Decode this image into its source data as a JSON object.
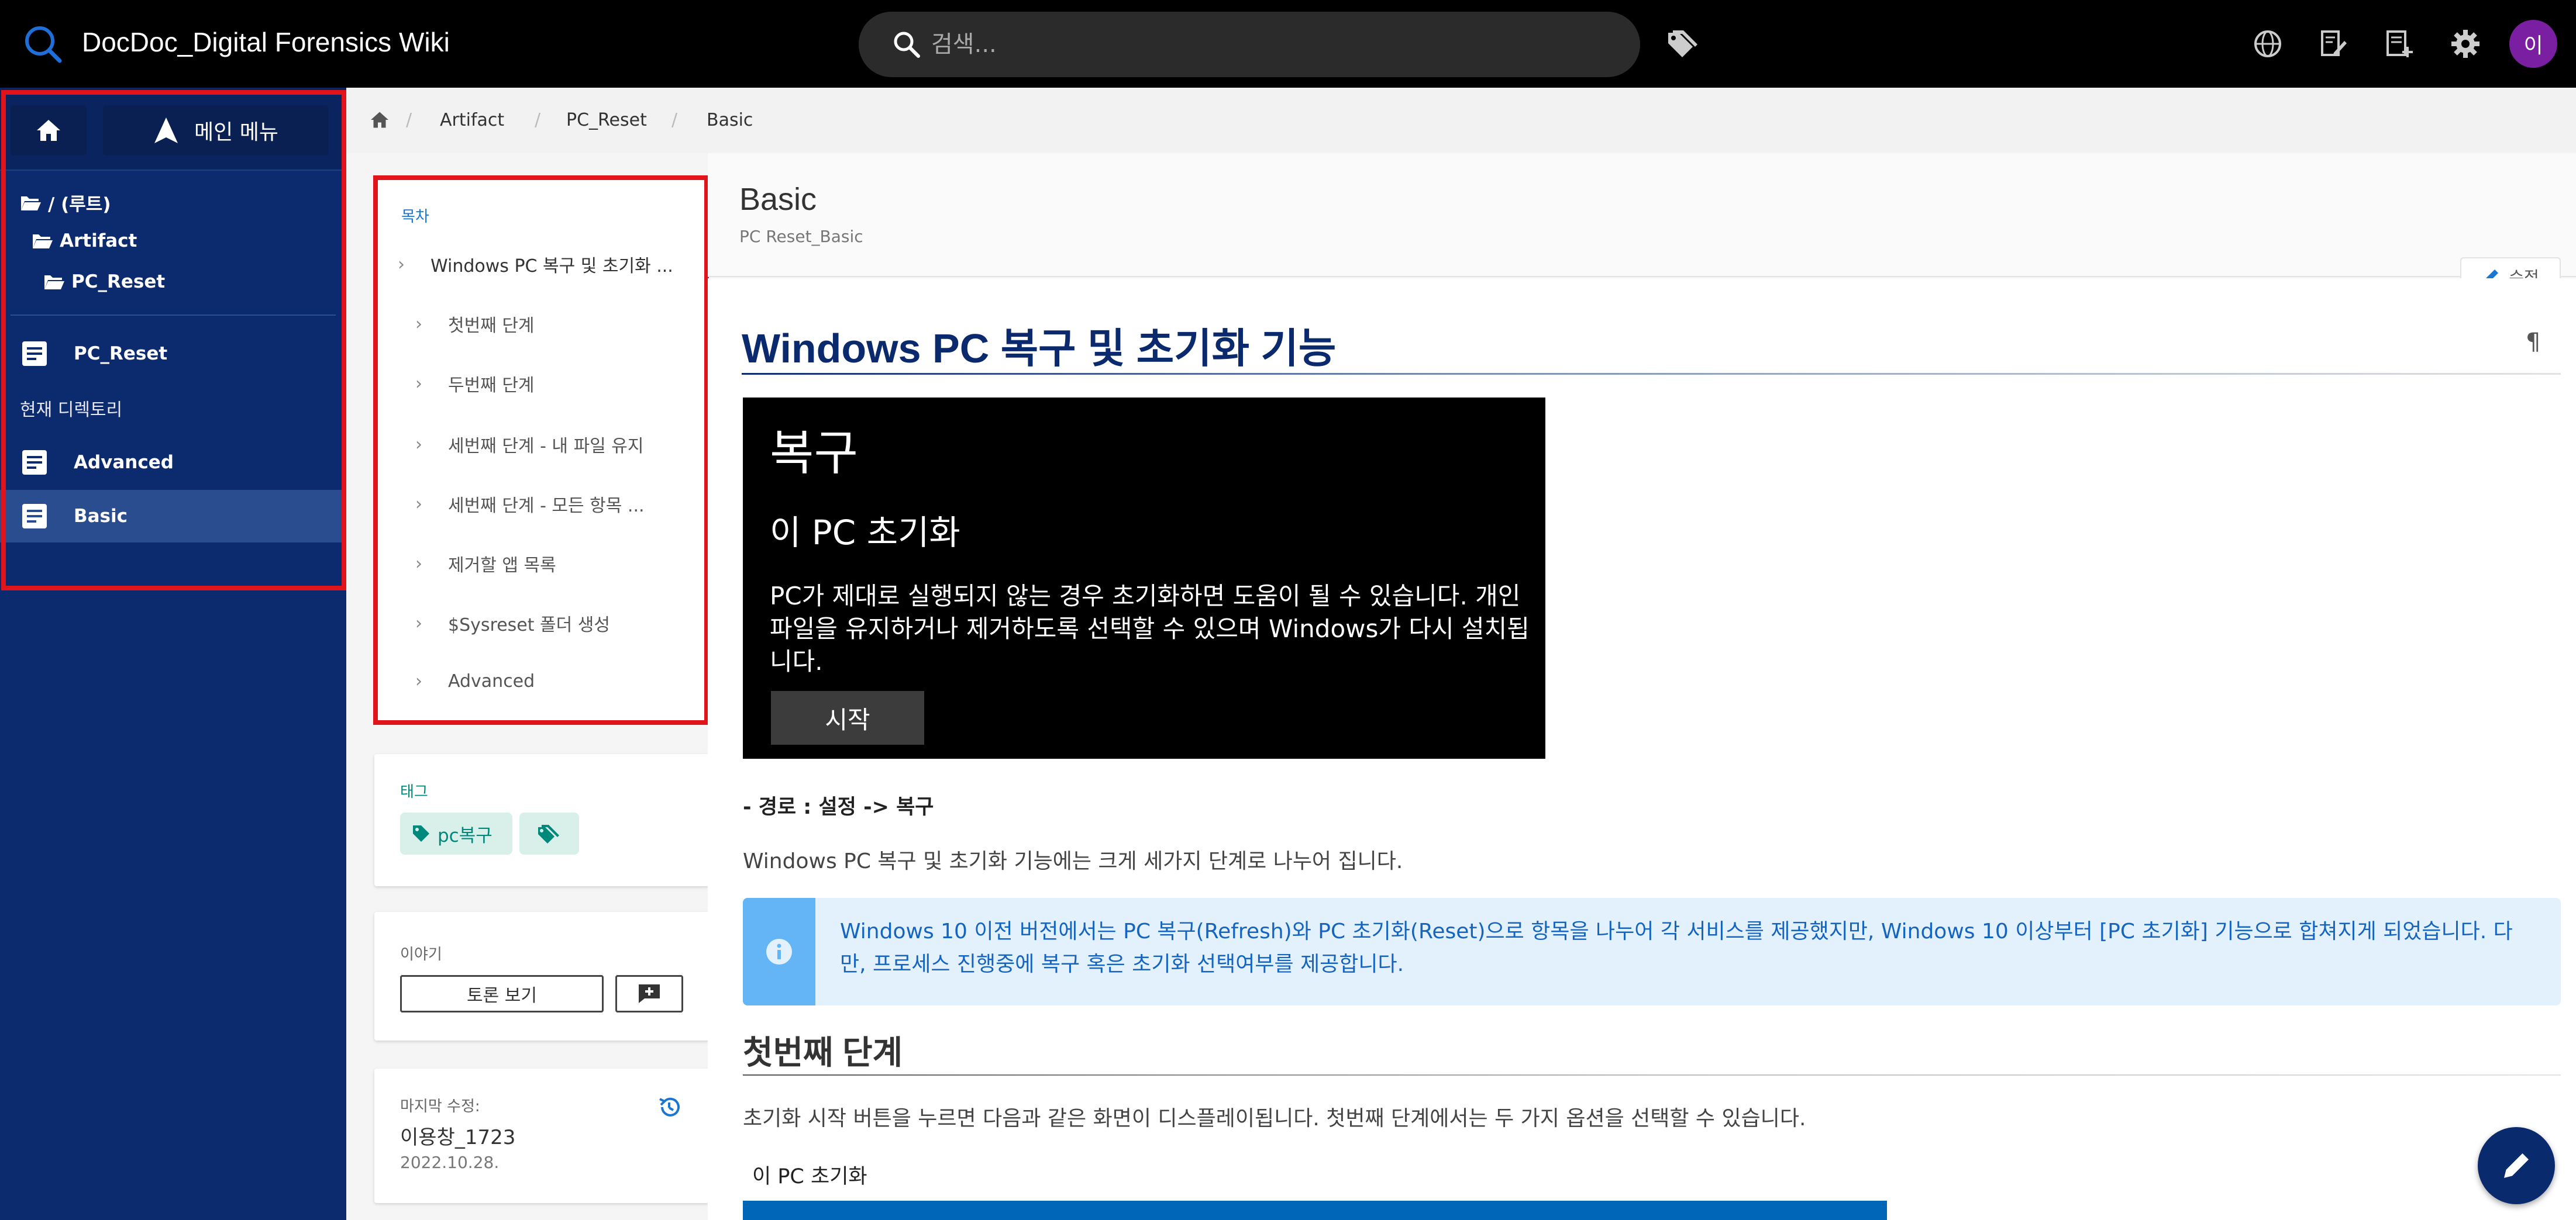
{
  "header": {
    "app_title": "DocDoc_Digital Forensics Wiki",
    "search_placeholder": "검색...",
    "avatar_initial": "이",
    "icons": [
      "search-icon",
      "tags-icon",
      "globe-icon",
      "edit-page-icon",
      "new-page-icon",
      "settings-icon"
    ]
  },
  "leftnav": {
    "main_menu_label": "메인 메뉴",
    "tree": [
      {
        "label": "/ (루트)",
        "icon": "folder-open-icon"
      },
      {
        "label": "Artifact",
        "icon": "folder-open-icon"
      },
      {
        "label": "PC_Reset",
        "icon": "folder-open-icon"
      }
    ],
    "parent_page": "PC_Reset",
    "section_label": "현재 디렉토리",
    "pages": [
      {
        "label": "Advanced",
        "active": false
      },
      {
        "label": "Basic",
        "active": true
      }
    ]
  },
  "breadcrumb": {
    "items": [
      "Artifact",
      "PC_Reset",
      "Basic"
    ]
  },
  "page": {
    "title": "Basic",
    "subtitle": "PC Reset_Basic",
    "edit_label": "수정"
  },
  "toc": {
    "title": "목차",
    "items": [
      {
        "label": "Windows PC 복구 및 초기화 ...",
        "level": 1
      },
      {
        "label": "첫번째 단계",
        "level": 2
      },
      {
        "label": "두번째 단계",
        "level": 2
      },
      {
        "label": "세번째 단계 - 내 파일 유지",
        "level": 2
      },
      {
        "label": "세번째 단계 - 모든 항목 ...",
        "level": 2
      },
      {
        "label": "제거할 앱 목록",
        "level": 2
      },
      {
        "label": "$Sysreset 폴더 생성",
        "level": 2
      },
      {
        "label": "Advanced",
        "level": 2
      }
    ]
  },
  "tags_card": {
    "label": "태그",
    "tag": "pc복구"
  },
  "discussion_card": {
    "label": "이야기",
    "button_label": "토론 보기"
  },
  "last_edit_card": {
    "label": "마지막 수정:",
    "author": "이용창_1723",
    "date": "2022.10.28."
  },
  "article": {
    "heading": "Windows PC 복구 및 초기화 기능",
    "screenshot": {
      "title": "복구",
      "subtitle": "이 PC 초기화",
      "body": "PC가 제대로 실행되지 않는 경우 초기화하면 도움이 될 수 있습니다. 개인 파일을 유지하거나 제거하도록 선택할 수 있으며 Windows가 다시 설치됩니다.",
      "button": "시작"
    },
    "path": "- 경로 : 설정 -> 복구",
    "intro": "Windows PC 복구 및 초기화 기능에는 크게 세가지 단계로 나누어 집니다.",
    "info": "Windows 10 이전 버전에서는 PC 복구(Refresh)와 PC 초기화(Reset)으로 항목을 나누어 각 서비스를 제공했지만, Windows 10 이상부터 [PC 초기화] 기능으로 합쳐지게 되었습니다. 다만, 프로세스 진행중에 복구 혹은 초기화 선택여부를 제공합니다.",
    "section1_heading": "첫번째 단계",
    "section1_text": "초기화 시작 버튼을 누르면 다음과 같은 화면이 디스플레이됩니다. 첫번째 단계에서는 두 가지 옵션을 선택할 수 있습니다.",
    "caption": "이 PC 초기화"
  },
  "colors": {
    "nav_bg": "#0c2a6e",
    "heading_blue": "#0b2a6e",
    "highlight_red": "#e0141a",
    "info_blue": "#1565c0",
    "tag_teal": "#00897b"
  }
}
